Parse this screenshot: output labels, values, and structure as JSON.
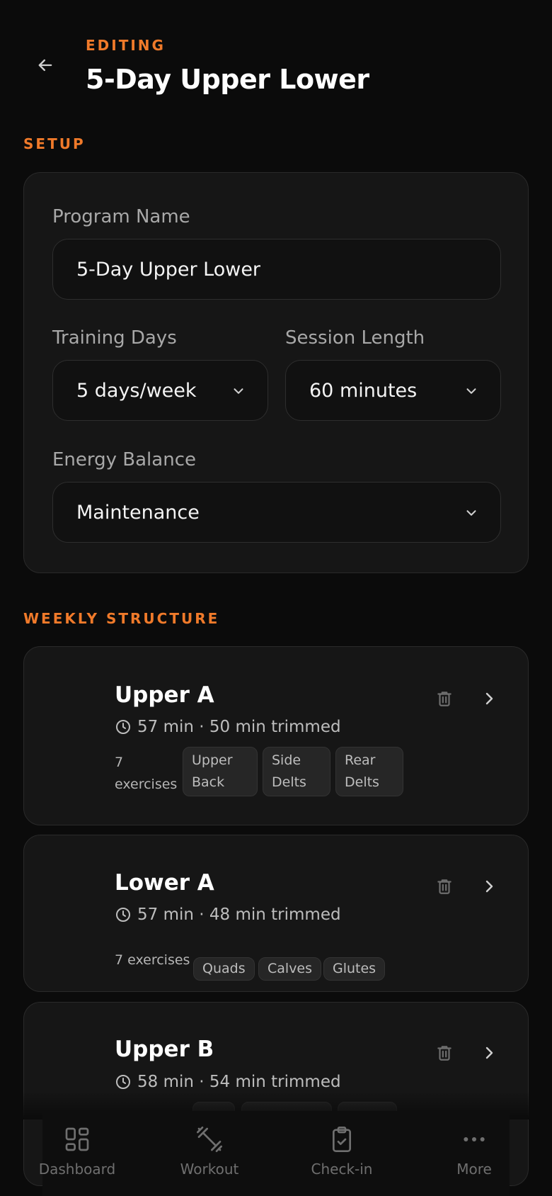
{
  "header": {
    "eyebrow": "EDITING",
    "title": "5-Day Upper Lower"
  },
  "setup": {
    "label": "SETUP",
    "program_name_label": "Program Name",
    "program_name_value": "5-Day Upper Lower",
    "training_days_label": "Training Days",
    "training_days_value": "5 days/week",
    "session_length_label": "Session Length",
    "session_length_value": "60 minutes",
    "energy_balance_label": "Energy Balance",
    "energy_balance_value": "Maintenance"
  },
  "weekly": {
    "label": "WEEKLY STRUCTURE",
    "days": [
      {
        "title": "Upper A",
        "meta": "57 min · 50 min trimmed",
        "count_line1": "7",
        "count_line2": "exercises",
        "tags": [
          [
            "Upper",
            "Back"
          ],
          [
            "Side",
            "Delts"
          ],
          [
            "Rear",
            "Delts"
          ]
        ]
      },
      {
        "title": "Lower A",
        "meta": "57 min · 48 min trimmed",
        "count": "7 exercises",
        "tags": [
          "Quads",
          "Calves",
          "Glutes"
        ]
      },
      {
        "title": "Upper B",
        "meta": "58 min · 54 min trimmed"
      }
    ]
  },
  "nav": [
    {
      "label": "Dashboard",
      "icon": "dashboard-icon"
    },
    {
      "label": "Workout",
      "icon": "dumbbell-icon"
    },
    {
      "label": "Check-in",
      "icon": "clipboard-check-icon"
    },
    {
      "label": "More",
      "icon": "more-icon"
    }
  ],
  "colors": {
    "accent": "#f07a2a",
    "background": "#0b0b0b",
    "card": "#161616"
  }
}
